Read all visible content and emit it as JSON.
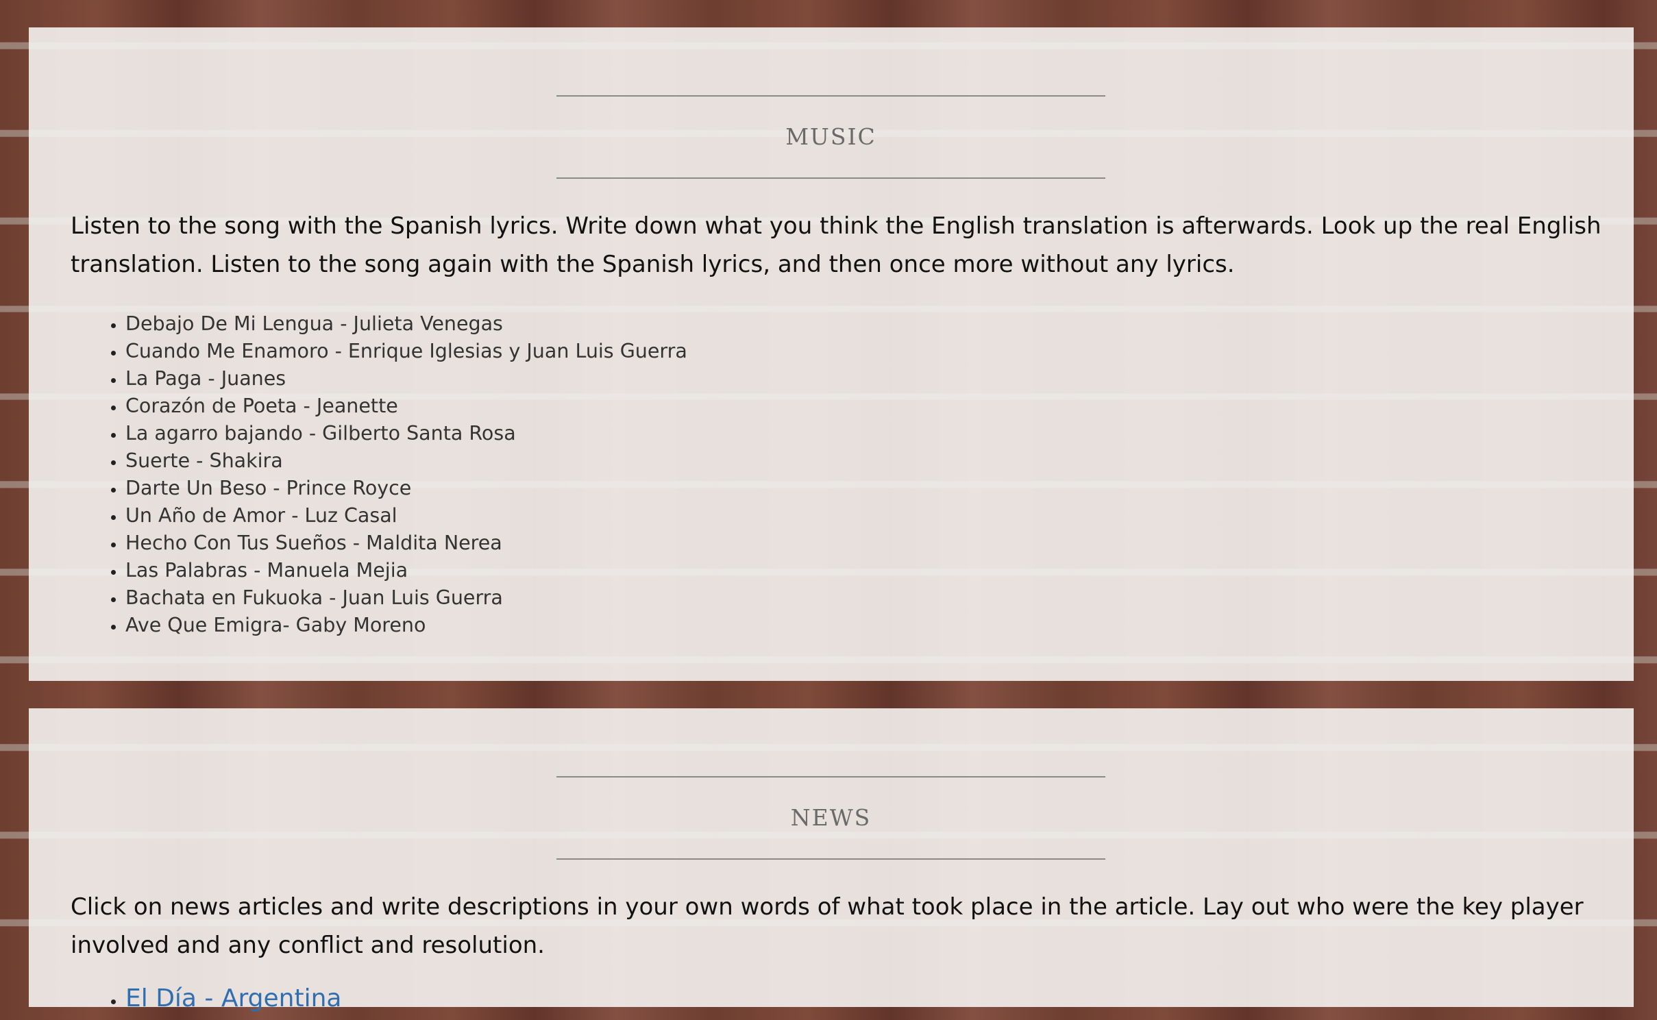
{
  "music": {
    "title": "MUSIC",
    "intro": "Listen to the song with the Spanish lyrics. Write down what you think the English translation is afterwards. Look up the real English translation. Listen to the song again with the Spanish lyrics, and then once more without any lyrics.",
    "songs": [
      "Debajo De Mi Lengua - Julieta Venegas",
      "Cuando Me Enamoro - Enrique Iglesias y Juan Luis Guerra",
      "La Paga - Juanes",
      "Corazón de Poeta - Jeanette",
      "La agarro bajando - Gilberto Santa Rosa",
      "Suerte - Shakira",
      "Darte Un Beso - Prince Royce",
      "Un Año de Amor - Luz Casal",
      "Hecho Con Tus Sueños - Maldita Nerea",
      "Las Palabras - Manuela Mejia",
      "Bachata en Fukuoka - Juan Luis Guerra",
      "Ave Que Emigra- Gaby Moreno"
    ]
  },
  "news": {
    "title": "NEWS",
    "intro": "Click on news articles and write descriptions in your own words of what took place in the article. Lay out who were the key player involved and any conflict and resolution.",
    "links": [
      "El Día - Argentina"
    ]
  },
  "colors": {
    "link": "#2f6fb0",
    "heading": "#6a6a6a",
    "rule": "#8a8a8a",
    "panel": "#f4f2f0"
  }
}
